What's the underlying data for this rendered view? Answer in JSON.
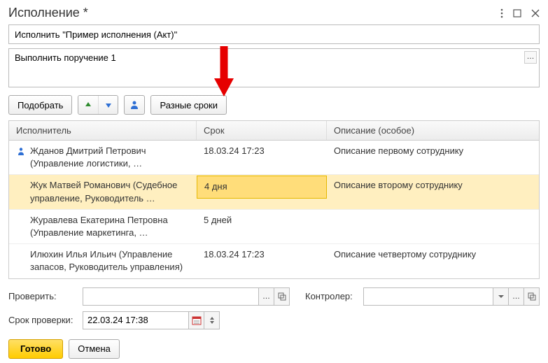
{
  "title": "Исполнение *",
  "task_name": "Исполнить \"Пример исполнения (Акт)\"",
  "description": "Выполнить поручение 1",
  "toolbar": {
    "pick": "Подобрать",
    "diff_dates": "Разные сроки"
  },
  "table": {
    "headers": {
      "executor": "Исполнитель",
      "deadline": "Срок",
      "desc": "Описание (особое)"
    },
    "rows": [
      {
        "name": "Жданов Дмитрий Петрович (Управление логистики, …",
        "deadline": "18.03.24 17:23",
        "desc": "Описание первому сотруднику",
        "selected": false,
        "has_icon": true
      },
      {
        "name": "Жук Матвей Романович (Судебное управление, Руководитель …",
        "deadline": "4 дня",
        "desc": "Описание второму сотруднику",
        "selected": true,
        "has_icon": false
      },
      {
        "name": "Журавлева Екатерина Петровна (Управление маркетинга, …",
        "deadline": "5 дней",
        "desc": "",
        "selected": false,
        "has_icon": false
      },
      {
        "name": "Илюхин Илья Ильич (Управление запасов, Руководитель управления)",
        "deadline": "18.03.24 17:23",
        "desc": "Описание четвертому сотруднику",
        "selected": false,
        "has_icon": false
      }
    ]
  },
  "form": {
    "check_label": "Проверить:",
    "check_value": "",
    "controller_label": "Контролер:",
    "controller_value": "",
    "deadline_label": "Срок проверки:",
    "deadline_value": "22.03.24 17:38"
  },
  "actions": {
    "done": "Готово",
    "cancel": "Отмена"
  }
}
